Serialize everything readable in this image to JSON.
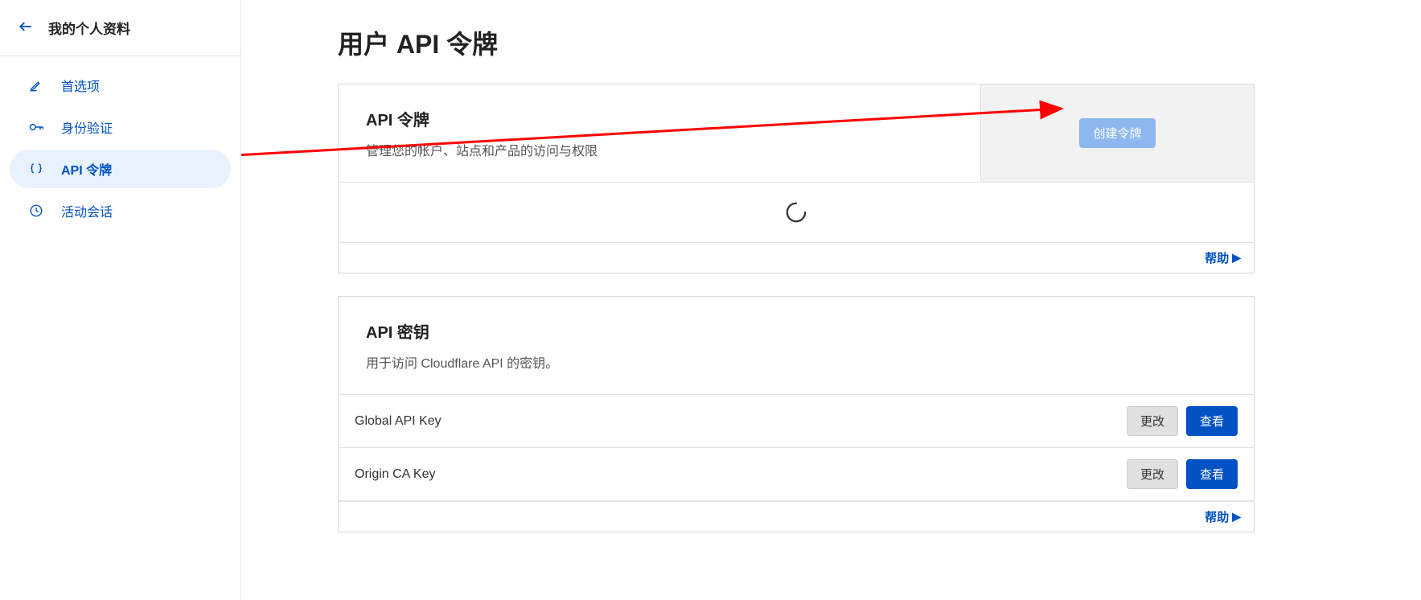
{
  "sidebar": {
    "title": "我的个人资料",
    "items": [
      {
        "label": "首选项",
        "icon": "edit"
      },
      {
        "label": "身份验证",
        "icon": "key"
      },
      {
        "label": "API 令牌",
        "icon": "braces"
      },
      {
        "label": "活动会话",
        "icon": "clock"
      }
    ],
    "active_index": 2
  },
  "main": {
    "page_title": "用户 API 令牌",
    "tokens_card": {
      "title": "API 令牌",
      "subtitle": "管理您的帐户、站点和产品的访问与权限",
      "create_button": "创建令牌",
      "help_link": "帮助"
    },
    "keys_card": {
      "title": "API 密钥",
      "subtitle": "用于访问 Cloudflare API 的密钥。",
      "rows": [
        {
          "label": "Global API Key",
          "change": "更改",
          "view": "查看"
        },
        {
          "label": "Origin CA Key",
          "change": "更改",
          "view": "查看"
        }
      ],
      "help_link": "帮助"
    }
  }
}
